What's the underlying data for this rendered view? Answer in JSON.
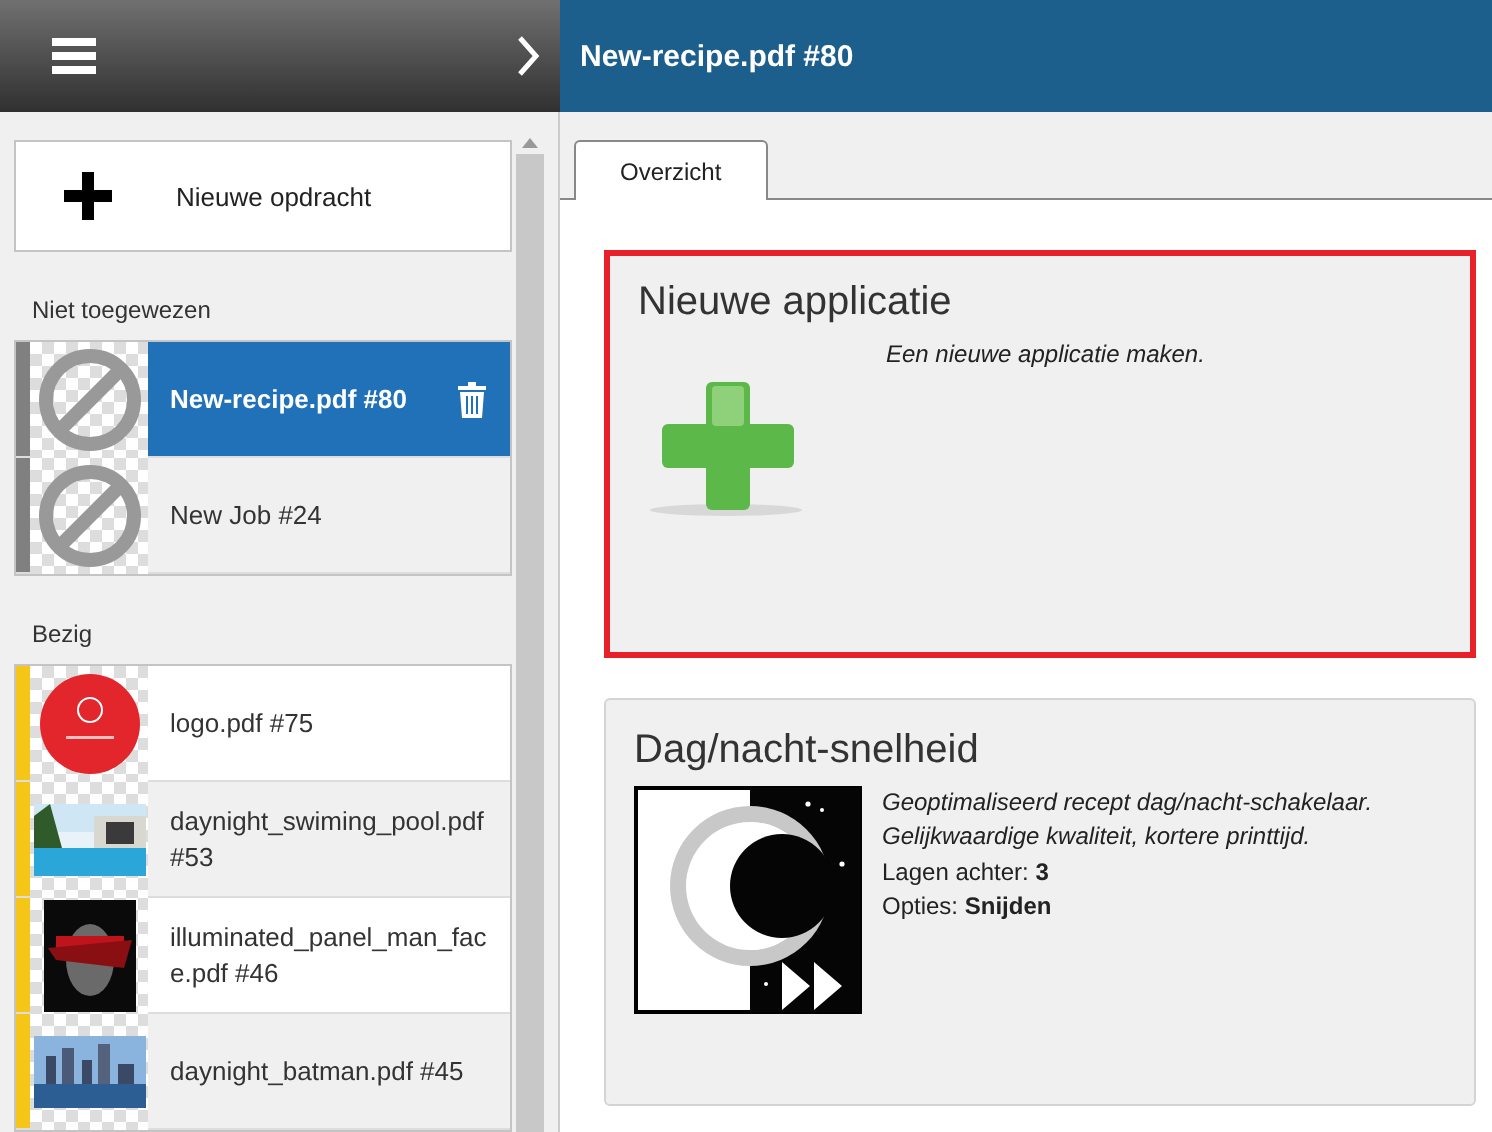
{
  "header": {
    "title": "New-recipe.pdf #80"
  },
  "sidebar": {
    "new_button": {
      "label": "Nieuwe opdracht"
    },
    "sections": [
      {
        "title": "Niet toegewezen",
        "items": [
          {
            "label": "New-recipe.pdf #80",
            "kind": "blocked",
            "color": "#808080",
            "selected": true
          },
          {
            "label": "New Job #24",
            "kind": "blocked",
            "color": "#808080",
            "selected": false
          }
        ]
      },
      {
        "title": "Bezig",
        "items": [
          {
            "label": "logo.pdf #75",
            "kind": "picture",
            "color": "#f5c518",
            "selected": false
          },
          {
            "label": "daynight_swiming_pool.pdf #53",
            "kind": "picture",
            "color": "#f5c518",
            "selected": false
          },
          {
            "label": "illuminated_panel_man_face.pdf #46",
            "kind": "picture",
            "color": "#f5c518",
            "selected": false
          },
          {
            "label": "daynight_batman.pdf #45",
            "kind": "picture",
            "color": "#f5c518",
            "selected": false
          }
        ]
      }
    ]
  },
  "tabs": [
    {
      "label": "Overzicht",
      "selected": true
    }
  ],
  "cards": [
    {
      "title": "Nieuwe applicatie",
      "highlighted": true,
      "lines": [
        "*Een nieuwe applicatie maken.*"
      ]
    },
    {
      "title": "Dag/nacht-snelheid",
      "highlighted": false,
      "lines": [
        "*Geoptimaliseerd recept dag/nacht-schakelaar.*",
        "*Gelijkwaardige kwaliteit, kortere printtijd.*",
        "Lagen achter: **3**",
        "Opties: **Snijden**"
      ]
    }
  ]
}
